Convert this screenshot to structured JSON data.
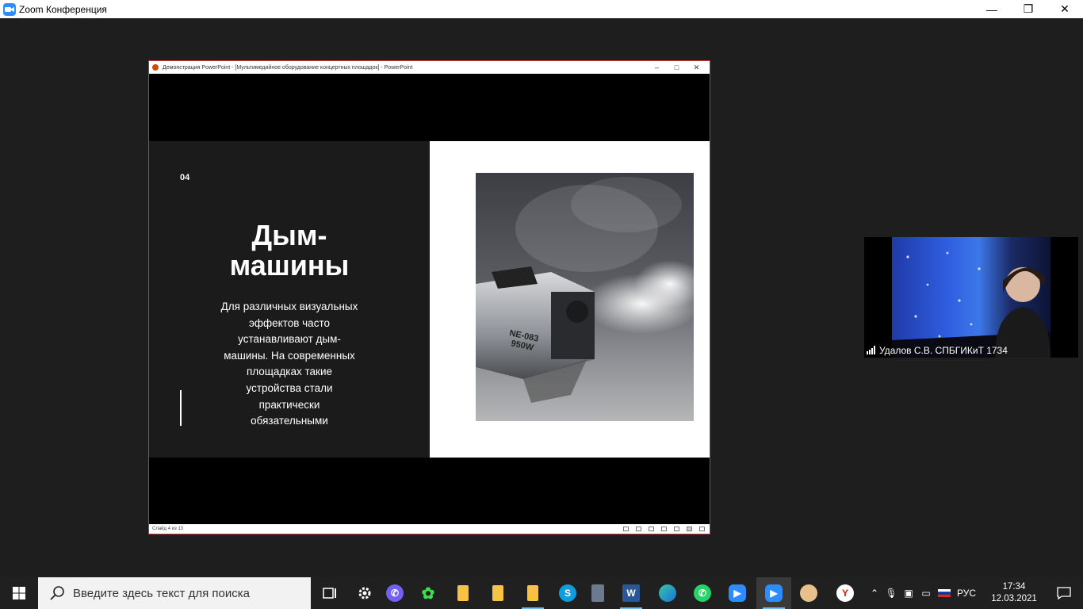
{
  "window": {
    "title": "Zoom Конференция",
    "controls": {
      "minimize": "—",
      "restore": "❐",
      "close": "✕"
    }
  },
  "shared_window": {
    "title": "Демонстрация PowerPoint - [Мультимедийное оборудование концертных площадок] - PowerPoint",
    "controls": {
      "minimize": "–",
      "maximize": "□",
      "close": "✕"
    },
    "slide": {
      "number": "04",
      "title_line1": "Дым-",
      "title_line2": "машины",
      "body_lines": [
        "Для различных визуальных",
        "эффектов часто",
        "устанавливают дым-",
        "машины. На современных",
        "площадках такие",
        "устройства стали",
        "практически",
        "обязательными"
      ],
      "photo_caption_lines": [
        "NE-083",
        "950W"
      ]
    },
    "status": "Слайд 4 из 13"
  },
  "participant": {
    "name": "Удалов С.В. СПБГИКиТ 1734"
  },
  "taskbar": {
    "search_placeholder": "Введите здесь текст для поиска",
    "apps": [
      {
        "name": "task-view",
        "label": ""
      },
      {
        "name": "settings",
        "label": ""
      },
      {
        "name": "viber",
        "label": ""
      },
      {
        "name": "icq",
        "label": ""
      },
      {
        "name": "folder-1",
        "label": ""
      },
      {
        "name": "folder-2",
        "label": ""
      },
      {
        "name": "folder-3",
        "label": ""
      },
      {
        "name": "skype",
        "label": "S"
      },
      {
        "name": "calculator",
        "label": ""
      },
      {
        "name": "word",
        "label": "W"
      },
      {
        "name": "edge",
        "label": ""
      },
      {
        "name": "whatsapp",
        "label": ""
      },
      {
        "name": "zoom-meetings",
        "label": ""
      },
      {
        "name": "zoom-active",
        "label": ""
      },
      {
        "name": "paint",
        "label": ""
      },
      {
        "name": "yandex",
        "label": "Y"
      }
    ],
    "language": "РУС",
    "time": "17:34",
    "date": "12.03.2021"
  }
}
